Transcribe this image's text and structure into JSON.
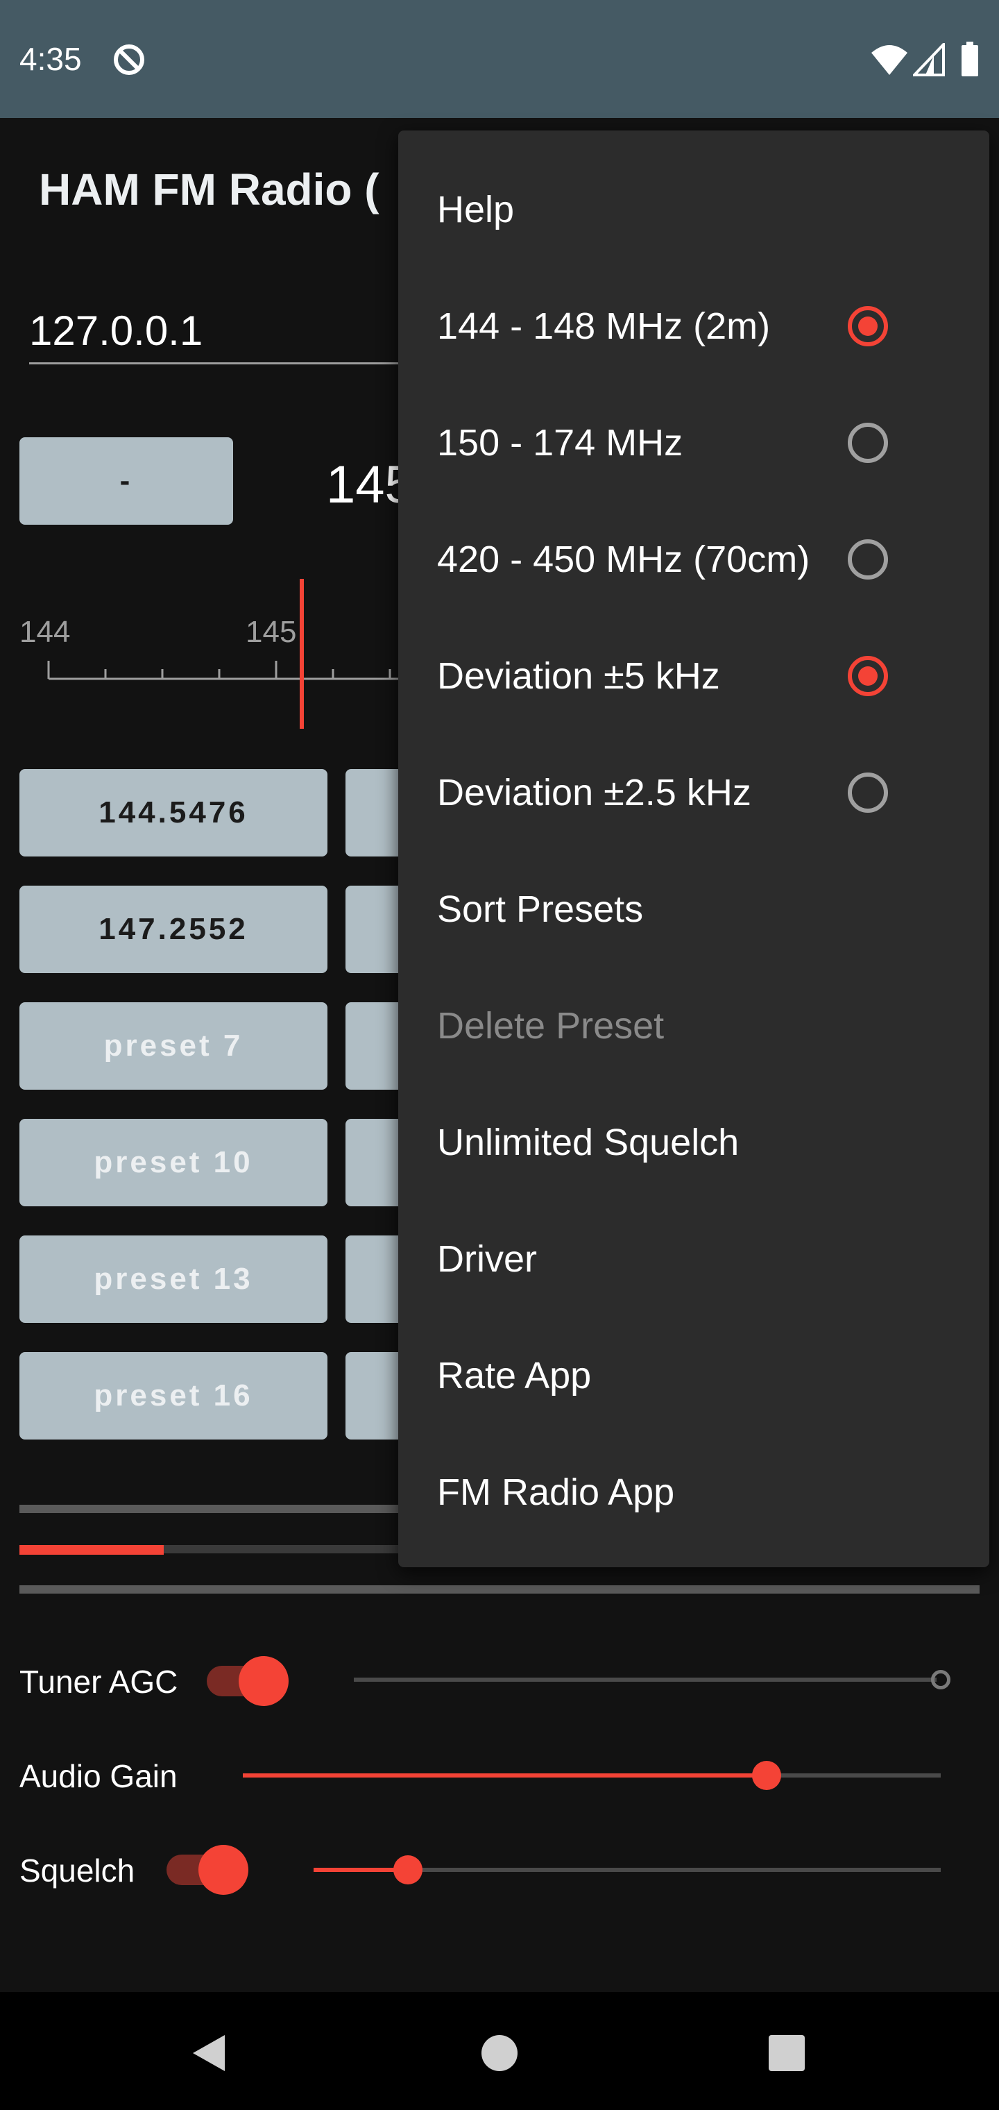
{
  "status_bar": {
    "time": "4:35"
  },
  "app": {
    "title": "HAM FM Radio ("
  },
  "host": {
    "value": "127.0.0.1"
  },
  "tuner": {
    "minus_label": "-",
    "frequency_partial": "145",
    "scale_labels": [
      "144",
      "145"
    ]
  },
  "presets": [
    {
      "label": "144.5476",
      "empty": false
    },
    {
      "label": "147.2552",
      "empty": false
    },
    {
      "label": "preset 7",
      "empty": true
    },
    {
      "label": "preset 10",
      "empty": true
    },
    {
      "label": "preset 13",
      "empty": true
    },
    {
      "label": "preset 16",
      "empty": true
    }
  ],
  "signal_progress": 0.15,
  "controls": {
    "tuner_agc_label": "Tuner AGC",
    "tuner_agc_on": true,
    "audio_gain_label": "Audio Gain",
    "audio_gain_level": 0.75,
    "squelch_label": "Squelch",
    "squelch_on": true,
    "squelch_level": 0.15
  },
  "menu": {
    "items": [
      {
        "label": "Help"
      },
      {
        "label": "144 - 148 MHz (2m)",
        "radio": true,
        "checked": true
      },
      {
        "label": "150 - 174 MHz",
        "radio": true,
        "checked": false
      },
      {
        "label": "420 - 450 MHz (70cm)",
        "radio": true,
        "checked": false
      },
      {
        "label": "Deviation ±5 kHz",
        "radio": true,
        "checked": true
      },
      {
        "label": "Deviation ±2.5 kHz",
        "radio": true,
        "checked": false
      },
      {
        "label": "Sort Presets"
      },
      {
        "label": "Delete Preset",
        "disabled": true
      },
      {
        "label": "Unlimited Squelch"
      },
      {
        "label": "Driver"
      },
      {
        "label": "Rate App"
      },
      {
        "label": "FM Radio App"
      }
    ]
  },
  "colors": {
    "accent": "#F44336",
    "status_bar": "#455A64",
    "button": "#B0BEC5",
    "menu_bg": "#2C2C2C"
  }
}
